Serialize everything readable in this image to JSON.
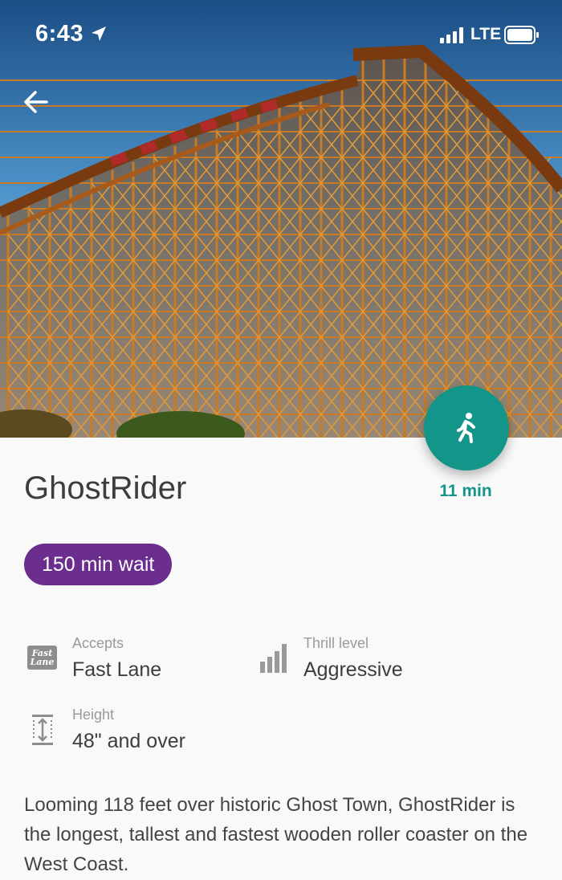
{
  "status_bar": {
    "time": "6:43",
    "network": "LTE",
    "location_icon": "location-arrow-icon",
    "signal_icon": "signal-bars-icon",
    "battery_icon": "battery-icon"
  },
  "navigation": {
    "back_icon": "arrow-back-icon"
  },
  "hero": {
    "image": "wooden-roller-coaster-photo"
  },
  "directions": {
    "icon": "walking-person-icon",
    "walk_time": "11 min",
    "color": "#14958a"
  },
  "ride": {
    "name": "GhostRider",
    "wait_badge": "150 min wait",
    "wait_badge_color": "#6b2d8e",
    "description": "Looming 118 feet over historic Ghost Town, GhostRider is the longest, tallest and fastest wooden roller coaster on the West Coast."
  },
  "attributes": {
    "accepts": {
      "label": "Accepts",
      "value": "Fast Lane",
      "icon": "fast-lane-icon",
      "icon_text_line1": "Fast",
      "icon_text_line2": "Lane"
    },
    "thrill": {
      "label": "Thrill level",
      "value": "Aggressive",
      "icon": "thrill-bars-icon"
    },
    "height": {
      "label": "Height",
      "value": "48\" and over",
      "icon": "height-ruler-icon"
    }
  }
}
